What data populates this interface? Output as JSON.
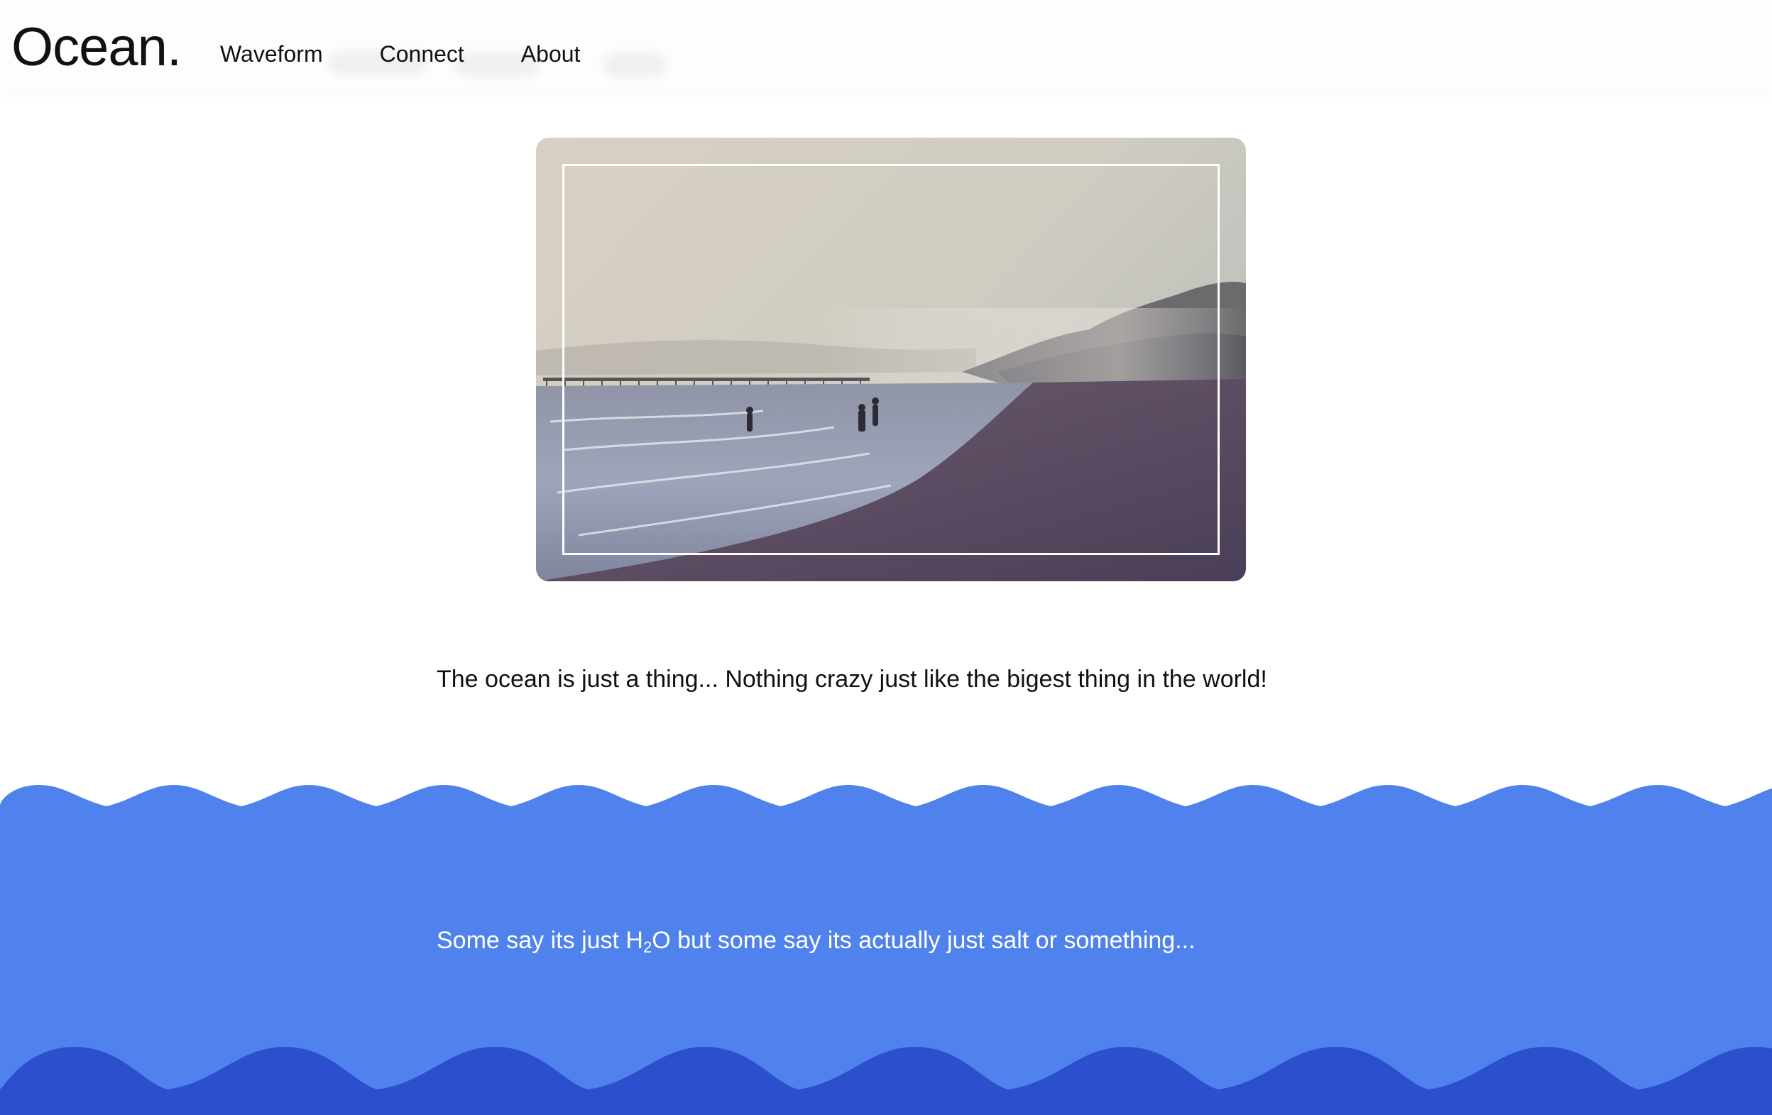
{
  "header": {
    "logo": "Ocean.",
    "nav": [
      {
        "label": "Waveform"
      },
      {
        "label": "Connect"
      },
      {
        "label": "About"
      }
    ]
  },
  "hero": {
    "image_alt": "beach-with-pier-photo"
  },
  "content": {
    "intro": "The ocean is just a thing... Nothing crazy just like the bigest thing in the world!",
    "h2o_prefix": "Some say its just H",
    "h2o_sub": "2",
    "h2o_suffix": "O but some say its actually just salt or something..."
  },
  "colors": {
    "wave_light": "#4f82ec",
    "wave_dark": "#2b4fcd",
    "text_dark": "#111111",
    "text_light": "#ffffff"
  }
}
